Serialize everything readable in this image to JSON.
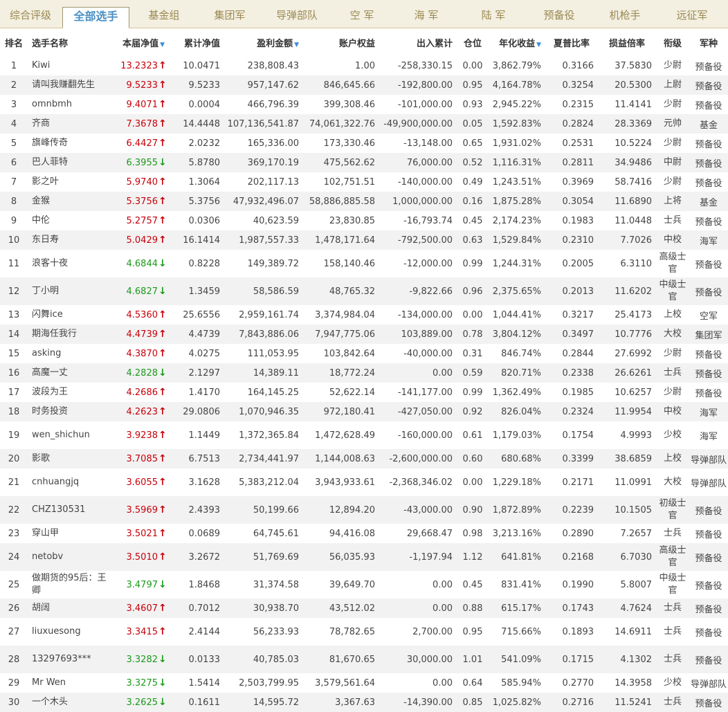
{
  "tabs": [
    {
      "label": "综合评级",
      "active": false
    },
    {
      "label": "全部选手",
      "active": true
    },
    {
      "label": "基金组",
      "active": false
    },
    {
      "label": "集团军",
      "active": false
    },
    {
      "label": "导弹部队",
      "active": false
    },
    {
      "label": "空 军",
      "active": false
    },
    {
      "label": "海 军",
      "active": false
    },
    {
      "label": "陆 军",
      "active": false
    },
    {
      "label": "预备役",
      "active": false
    },
    {
      "label": "机枪手",
      "active": false
    },
    {
      "label": "远征军",
      "active": false
    }
  ],
  "columns": [
    {
      "label": "排名",
      "sort": false
    },
    {
      "label": "选手名称",
      "sort": false
    },
    {
      "label": "本届净值",
      "sort": true
    },
    {
      "label": "累计净值",
      "sort": false
    },
    {
      "label": "盈利金额",
      "sort": true
    },
    {
      "label": "账户权益",
      "sort": false
    },
    {
      "label": "出入累计",
      "sort": false
    },
    {
      "label": "仓位",
      "sort": false
    },
    {
      "label": "年化收益",
      "sort": true
    },
    {
      "label": "夏普比率",
      "sort": false
    },
    {
      "label": "损益倍率",
      "sort": false
    },
    {
      "label": "衔级",
      "sort": false
    },
    {
      "label": "军种",
      "sort": false
    }
  ],
  "sort_indicator": "▼",
  "trend_icons": {
    "up": "arrow-up-icon",
    "down": "arrow-down-icon",
    "up_color": "#c7000a",
    "down_color": "#1a9a1a"
  },
  "rows": [
    {
      "rank": "1",
      "name": "Kiwi",
      "net": "13.2323",
      "trend": "up",
      "cum": "10.0471",
      "profit": "238,808.43",
      "equity": "1.00",
      "flow": "-258,330.15",
      "pos": "0.00",
      "annual": "3,862.79%",
      "sharpe": "0.3166",
      "ratio": "37.5830",
      "grade": "少尉",
      "branch": "预备役"
    },
    {
      "rank": "2",
      "name": "请叫我赚翻先生",
      "net": "9.5233",
      "trend": "up",
      "cum": "9.5233",
      "profit": "957,147.62",
      "equity": "846,645.66",
      "flow": "-192,800.00",
      "pos": "0.95",
      "annual": "4,164.78%",
      "sharpe": "0.3254",
      "ratio": "20.5300",
      "grade": "上尉",
      "branch": "预备役"
    },
    {
      "rank": "3",
      "name": "omnbmh",
      "net": "9.4071",
      "trend": "up",
      "cum": "0.0004",
      "profit": "466,796.39",
      "equity": "399,308.46",
      "flow": "-101,000.00",
      "pos": "0.93",
      "annual": "2,945.22%",
      "sharpe": "0.2315",
      "ratio": "11.4141",
      "grade": "少尉",
      "branch": "预备役"
    },
    {
      "rank": "4",
      "name": "齐商",
      "net": "7.3678",
      "trend": "up",
      "cum": "14.4448",
      "profit": "107,136,541.87",
      "equity": "74,061,322.76",
      "flow": "-49,900,000.00",
      "pos": "0.05",
      "annual": "1,592.83%",
      "sharpe": "0.2824",
      "ratio": "28.3369",
      "grade": "元帅",
      "branch": "基金"
    },
    {
      "rank": "5",
      "name": "旗峰传奇",
      "net": "6.4427",
      "trend": "up",
      "cum": "2.0232",
      "profit": "165,336.00",
      "equity": "173,330.46",
      "flow": "-13,148.00",
      "pos": "0.65",
      "annual": "1,931.02%",
      "sharpe": "0.2531",
      "ratio": "10.5224",
      "grade": "少尉",
      "branch": "预备役"
    },
    {
      "rank": "6",
      "name": "巴人菲特",
      "net": "6.3955",
      "trend": "down",
      "cum": "5.8780",
      "profit": "369,170.19",
      "equity": "475,562.62",
      "flow": "76,000.00",
      "pos": "0.52",
      "annual": "1,116.31%",
      "sharpe": "0.2811",
      "ratio": "34.9486",
      "grade": "中尉",
      "branch": "预备役"
    },
    {
      "rank": "7",
      "name": "影之叶",
      "net": "5.9740",
      "trend": "up",
      "cum": "1.3064",
      "profit": "202,117.13",
      "equity": "102,751.51",
      "flow": "-140,000.00",
      "pos": "0.49",
      "annual": "1,243.51%",
      "sharpe": "0.3969",
      "ratio": "58.7416",
      "grade": "少尉",
      "branch": "预备役"
    },
    {
      "rank": "8",
      "name": "金猴",
      "net": "5.3756",
      "trend": "up",
      "cum": "5.3756",
      "profit": "47,932,496.07",
      "equity": "58,886,885.58",
      "flow": "1,000,000.00",
      "pos": "0.16",
      "annual": "1,875.28%",
      "sharpe": "0.3054",
      "ratio": "11.6890",
      "grade": "上将",
      "branch": "基金"
    },
    {
      "rank": "9",
      "name": "中伦",
      "net": "5.2757",
      "trend": "up",
      "cum": "0.0306",
      "profit": "40,623.59",
      "equity": "23,830.85",
      "flow": "-16,793.74",
      "pos": "0.45",
      "annual": "2,174.23%",
      "sharpe": "0.1983",
      "ratio": "11.0448",
      "grade": "士兵",
      "branch": "预备役"
    },
    {
      "rank": "10",
      "name": "东日寿",
      "net": "5.0429",
      "trend": "up",
      "cum": "16.1414",
      "profit": "1,987,557.33",
      "equity": "1,478,171.64",
      "flow": "-792,500.00",
      "pos": "0.63",
      "annual": "1,529.84%",
      "sharpe": "0.2310",
      "ratio": "7.7026",
      "grade": "中校",
      "branch": "海军"
    },
    {
      "rank": "11",
      "name": "浪客十夜",
      "net": "4.6844",
      "trend": "down",
      "cum": "0.8228",
      "profit": "149,389.72",
      "equity": "158,140.46",
      "flow": "-12,000.00",
      "pos": "0.99",
      "annual": "1,244.31%",
      "sharpe": "0.2005",
      "ratio": "6.3110",
      "grade": "高级士官",
      "branch": "预备役"
    },
    {
      "rank": "12",
      "name": "丁小明",
      "net": "4.6827",
      "trend": "down",
      "cum": "1.3459",
      "profit": "58,586.59",
      "equity": "48,765.32",
      "flow": "-9,822.66",
      "pos": "0.96",
      "annual": "2,375.65%",
      "sharpe": "0.2013",
      "ratio": "11.6202",
      "grade": "中级士官",
      "branch": "预备役"
    },
    {
      "rank": "13",
      "name": "闪舞ice",
      "net": "4.5360",
      "trend": "up",
      "cum": "25.6556",
      "profit": "2,959,161.74",
      "equity": "3,374,984.04",
      "flow": "-134,000.00",
      "pos": "0.00",
      "annual": "1,044.41%",
      "sharpe": "0.3217",
      "ratio": "25.4173",
      "grade": "上校",
      "branch": "空军"
    },
    {
      "rank": "14",
      "name": "期海任我行",
      "net": "4.4739",
      "trend": "up",
      "cum": "4.4739",
      "profit": "7,843,886.06",
      "equity": "7,947,775.06",
      "flow": "103,889.00",
      "pos": "0.78",
      "annual": "3,804.12%",
      "sharpe": "0.3497",
      "ratio": "10.7776",
      "grade": "大校",
      "branch": "集团军"
    },
    {
      "rank": "15",
      "name": "asking",
      "net": "4.3870",
      "trend": "up",
      "cum": "4.0275",
      "profit": "111,053.95",
      "equity": "103,842.64",
      "flow": "-40,000.00",
      "pos": "0.31",
      "annual": "846.74%",
      "sharpe": "0.2844",
      "ratio": "27.6992",
      "grade": "少尉",
      "branch": "预备役"
    },
    {
      "rank": "16",
      "name": "高魔一丈",
      "net": "4.2828",
      "trend": "down",
      "cum": "2.1297",
      "profit": "14,389.11",
      "equity": "18,772.24",
      "flow": "0.00",
      "pos": "0.59",
      "annual": "820.71%",
      "sharpe": "0.2338",
      "ratio": "26.6261",
      "grade": "士兵",
      "branch": "预备役"
    },
    {
      "rank": "17",
      "name": "波段为王",
      "net": "4.2686",
      "trend": "up",
      "cum": "1.4170",
      "profit": "164,145.25",
      "equity": "52,622.14",
      "flow": "-141,177.00",
      "pos": "0.99",
      "annual": "1,362.49%",
      "sharpe": "0.1985",
      "ratio": "10.6257",
      "grade": "少尉",
      "branch": "预备役"
    },
    {
      "rank": "18",
      "name": "时务投资",
      "net": "4.2623",
      "trend": "up",
      "cum": "29.0806",
      "profit": "1,070,946.35",
      "equity": "972,180.41",
      "flow": "-427,050.00",
      "pos": "0.92",
      "annual": "826.04%",
      "sharpe": "0.2324",
      "ratio": "11.9954",
      "grade": "中校",
      "branch": "海军"
    },
    {
      "rank": "19",
      "name": "wen_shichun",
      "net": "3.9238",
      "trend": "up",
      "cum": "1.1449",
      "profit": "1,372,365.84",
      "equity": "1,472,628.49",
      "flow": "-160,000.00",
      "pos": "0.61",
      "annual": "1,179.03%",
      "sharpe": "0.1754",
      "ratio": "4.9993",
      "grade": "少校",
      "branch": "海军"
    },
    {
      "rank": "20",
      "name": "影歌",
      "net": "3.7085",
      "trend": "up",
      "cum": "6.7513",
      "profit": "2,734,441.97",
      "equity": "1,144,008.63",
      "flow": "-2,600,000.00",
      "pos": "0.60",
      "annual": "680.68%",
      "sharpe": "0.3399",
      "ratio": "38.6859",
      "grade": "上校",
      "branch": "导弹部队"
    },
    {
      "rank": "21",
      "name": "cnhuangjq",
      "net": "3.6055",
      "trend": "up",
      "cum": "3.1628",
      "profit": "5,383,212.04",
      "equity": "3,943,933.61",
      "flow": "-2,368,346.02",
      "pos": "0.00",
      "annual": "1,229.18%",
      "sharpe": "0.2171",
      "ratio": "11.0991",
      "grade": "大校",
      "branch": "导弹部队"
    },
    {
      "rank": "22",
      "name": "CHZ130531",
      "net": "3.5969",
      "trend": "up",
      "cum": "2.4393",
      "profit": "50,199.66",
      "equity": "12,894.20",
      "flow": "-43,000.00",
      "pos": "0.90",
      "annual": "1,872.89%",
      "sharpe": "0.2239",
      "ratio": "10.1505",
      "grade": "初级士官",
      "branch": "预备役"
    },
    {
      "rank": "23",
      "name": "穿山甲",
      "net": "3.5021",
      "trend": "up",
      "cum": "0.0689",
      "profit": "64,745.61",
      "equity": "94,416.08",
      "flow": "29,668.47",
      "pos": "0.98",
      "annual": "3,213.16%",
      "sharpe": "0.2890",
      "ratio": "7.2657",
      "grade": "士兵",
      "branch": "预备役"
    },
    {
      "rank": "24",
      "name": "netobv",
      "net": "3.5010",
      "trend": "up",
      "cum": "3.2672",
      "profit": "51,769.69",
      "equity": "56,035.93",
      "flow": "-1,197.94",
      "pos": "1.12",
      "annual": "641.81%",
      "sharpe": "0.2168",
      "ratio": "6.7030",
      "grade": "高级士官",
      "branch": "预备役"
    },
    {
      "rank": "25",
      "name": "做期货的95后：王卿",
      "net": "3.4797",
      "trend": "down",
      "cum": "1.8468",
      "profit": "31,374.58",
      "equity": "39,649.70",
      "flow": "0.00",
      "pos": "0.45",
      "annual": "831.41%",
      "sharpe": "0.1990",
      "ratio": "5.8007",
      "grade": "中级士官",
      "branch": "预备役"
    },
    {
      "rank": "26",
      "name": "胡阔",
      "net": "3.4607",
      "trend": "up",
      "cum": "0.7012",
      "profit": "30,938.70",
      "equity": "43,512.02",
      "flow": "0.00",
      "pos": "0.88",
      "annual": "615.17%",
      "sharpe": "0.1743",
      "ratio": "4.7624",
      "grade": "士兵",
      "branch": "预备役"
    },
    {
      "rank": "27",
      "name": "liuxuesong",
      "net": "3.3415",
      "trend": "up",
      "cum": "2.4144",
      "profit": "56,233.93",
      "equity": "78,782.65",
      "flow": "2,700.00",
      "pos": "0.95",
      "annual": "715.66%",
      "sharpe": "0.1893",
      "ratio": "14.6911",
      "grade": "士兵",
      "branch": "预备役"
    },
    {
      "rank": "28",
      "name": "13297693***",
      "net": "3.3282",
      "trend": "down",
      "cum": "0.0133",
      "profit": "40,785.03",
      "equity": "81,670.65",
      "flow": "30,000.00",
      "pos": "1.01",
      "annual": "541.09%",
      "sharpe": "0.1715",
      "ratio": "4.1302",
      "grade": "士兵",
      "branch": "预备役"
    },
    {
      "rank": "29",
      "name": "Mr Wen",
      "net": "3.3275",
      "trend": "down",
      "cum": "1.5414",
      "profit": "2,503,799.95",
      "equity": "3,579,561.64",
      "flow": "0.00",
      "pos": "0.64",
      "annual": "585.94%",
      "sharpe": "0.2770",
      "ratio": "14.3958",
      "grade": "少校",
      "branch": "导弹部队"
    },
    {
      "rank": "30",
      "name": "一个木头",
      "net": "3.2625",
      "trend": "down",
      "cum": "0.1611",
      "profit": "14,595.72",
      "equity": "3,367.63",
      "flow": "-14,390.00",
      "pos": "0.85",
      "annual": "1,025.82%",
      "sharpe": "0.2716",
      "ratio": "11.5241",
      "grade": "士兵",
      "branch": "预备役"
    }
  ]
}
